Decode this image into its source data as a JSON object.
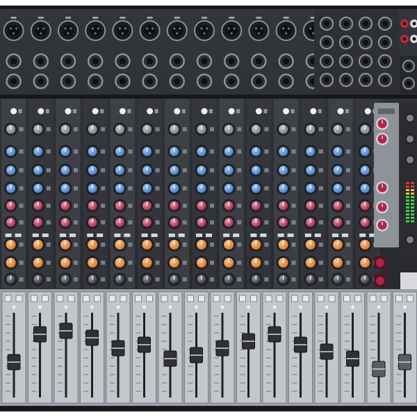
{
  "image": {
    "subject": "analog-mixing-console",
    "view": "top-down",
    "palette": {
      "chassis": "#2a2c30",
      "chassis_dark": "#17181b",
      "strip": "#3a3d43",
      "strip_light": "#4a4e55",
      "jack": "#0f1012",
      "jack_ring": "#8d929a",
      "led_white": "#f2f2ee",
      "knob_grey": "#7c8189",
      "knob_blue": "#3d7fd0",
      "knob_red": "#b0254a",
      "knob_orange": "#e27a1c",
      "knob_dark": "#2c2e33",
      "fader_lane": "#c3c6cb",
      "fader_cap": "#2f3136",
      "meter_green": "#3fd04a",
      "meter_red": "#e0323a",
      "background": "#ffffff"
    },
    "channels": {
      "mono_count": 12,
      "stereo_count": 2
    }
  }
}
